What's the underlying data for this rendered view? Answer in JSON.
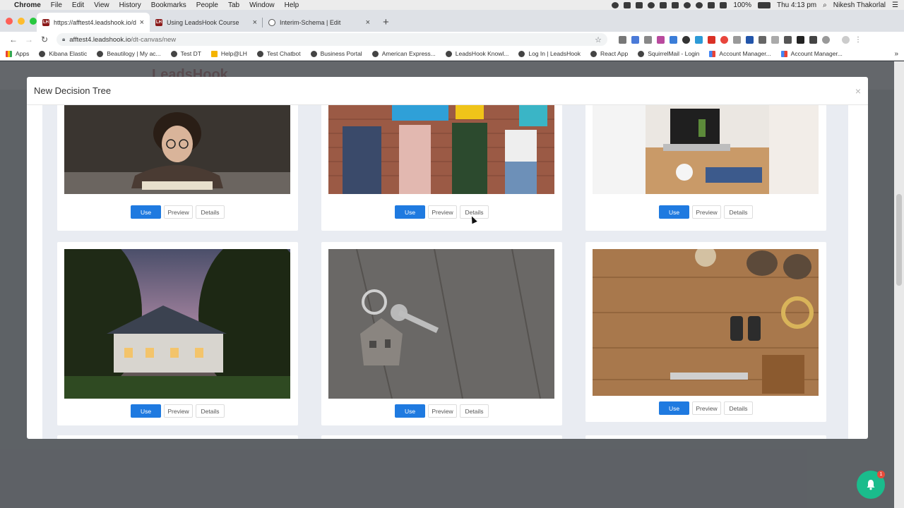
{
  "menubar": {
    "app": "Chrome",
    "items": [
      "File",
      "Edit",
      "View",
      "History",
      "Bookmarks",
      "People",
      "Tab",
      "Window",
      "Help"
    ],
    "battery": "100%",
    "clock": "Thu 4:13 pm",
    "user": "Nikesh Thakorlal"
  },
  "tabs": [
    {
      "title": "https://afftest4.leadshook.io/d",
      "favicon": "LH",
      "color": "#8b1a1a"
    },
    {
      "title": "Using LeadsHook Course",
      "favicon": "LH",
      "color": "#8b1a1a"
    },
    {
      "title": "Interim-Schema | Edit",
      "favicon": "smile-icon",
      "color": "#555555"
    }
  ],
  "toolbar": {
    "url_host": "afftest4.leadshook.io",
    "url_path": "/dt-canvas/new"
  },
  "bookmarks": [
    {
      "label": "Apps",
      "icon": "grid"
    },
    {
      "label": "Kibana Elastic",
      "icon": "globe"
    },
    {
      "label": "Beautilogy | My ac...",
      "icon": "globe"
    },
    {
      "label": "Test DT",
      "icon": "globe"
    },
    {
      "label": "Help@LH",
      "icon": "folder"
    },
    {
      "label": "Test Chatbot",
      "icon": "globe"
    },
    {
      "label": "Business Portal",
      "icon": "globe"
    },
    {
      "label": "American Express...",
      "icon": "globe"
    },
    {
      "label": "LeadsHook Knowl...",
      "icon": "globe"
    },
    {
      "label": "Log In | LeadsHook",
      "icon": "globe"
    },
    {
      "label": "React App",
      "icon": "globe"
    },
    {
      "label": "SquirrelMail - Login",
      "icon": "globe"
    },
    {
      "label": "Account Manager...",
      "icon": "multi"
    },
    {
      "label": "Account Manager...",
      "icon": "multi"
    }
  ],
  "modal": {
    "title": "New Decision Tree",
    "close": "×"
  },
  "buttons": {
    "use": "Use",
    "preview": "Preview",
    "details": "Details"
  },
  "templates": [
    {
      "image": "man-with-book"
    },
    {
      "image": "people-share-signs"
    },
    {
      "image": "office-laptop-meeting"
    },
    {
      "image": "house-at-dusk"
    },
    {
      "image": "house-keychain"
    },
    {
      "image": "hiking-gear-table"
    }
  ],
  "notification": {
    "count": "1"
  },
  "colors": {
    "primary": "#1f7ae0",
    "bell": "#1abc8c",
    "badge": "#e74c3c"
  }
}
